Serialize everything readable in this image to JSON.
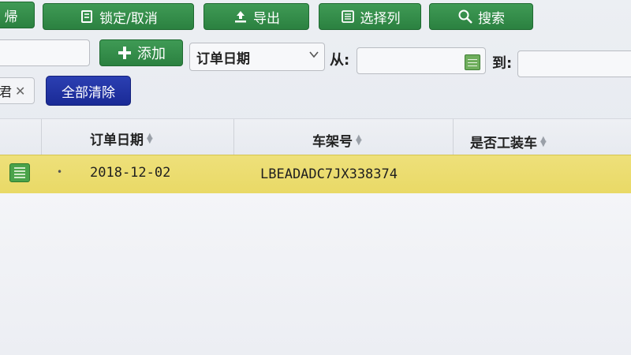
{
  "toolbar": {
    "prev_label": "帰",
    "lock_label": "锁定/取消",
    "export_label": "导出",
    "columns_label": "选择列",
    "search_label": "搜索"
  },
  "filter_bar": {
    "add_label": "添加",
    "date_field": "订单日期",
    "from_label": "从:",
    "to_label": "到:"
  },
  "chips": {
    "active_chip_label": "君",
    "clear_all_label": "全部清除"
  },
  "table": {
    "headers": [
      "订单日期",
      "车架号",
      "是否工装车"
    ],
    "rows": [
      {
        "order_date": "2018-12-02",
        "vin": "LBEADADC7JX338374",
        "tooling": ""
      }
    ]
  },
  "colors": {
    "button_green": "#2b8140",
    "button_blue": "#1a2a96",
    "row_highlight": "#eee07a"
  }
}
